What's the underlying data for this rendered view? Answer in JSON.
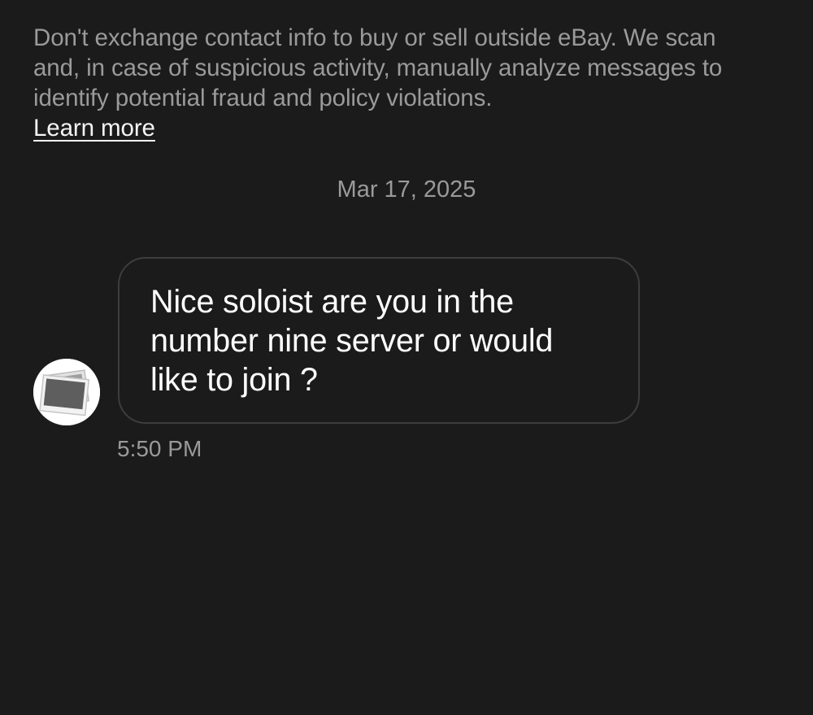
{
  "notice": {
    "text": "Don't exchange contact info to buy or sell outside eBay. We scan and, in case of suspicious activity, manually analyze messages to identify potential fraud and policy violations.",
    "learn_more": "Learn more"
  },
  "conversation": {
    "date_separator": "Mar 17, 2025",
    "messages": [
      {
        "sender_avatar_icon": "image-placeholder-icon",
        "text": "Nice soloist are you in the number nine server or would like to join ?",
        "time": "5:50 PM"
      }
    ]
  },
  "colors": {
    "background": "#1b1b1b",
    "muted_text": "#9a9a9a",
    "primary_text": "#ffffff",
    "bubble_border": "#3d3d3d"
  }
}
